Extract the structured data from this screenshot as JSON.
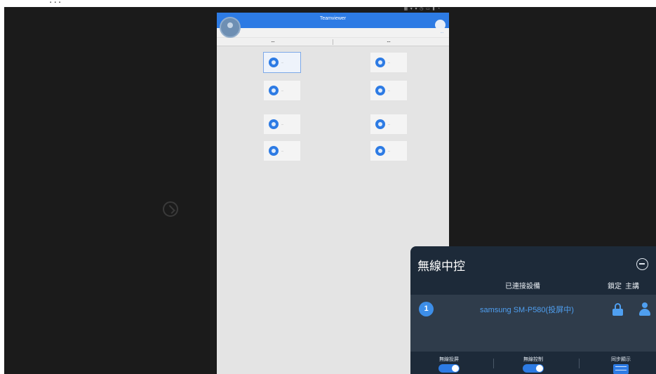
{
  "page": {
    "caption": "...",
    "status_bar_text": "▦ ▾ ▾ ◷ ▭ ▮ ◔"
  },
  "app": {
    "title": "Teamviewer",
    "subtitle": "...",
    "subtitle_link": "...",
    "columns": {
      "left": "...",
      "right": "..."
    },
    "tiles": [
      {
        "label": "...",
        "icon": "circle-app-icon",
        "selected": true
      },
      {
        "label": "...",
        "icon": "circle-app-icon",
        "selected": false
      },
      {
        "label": "...",
        "icon": "circle-app-icon",
        "selected": false
      },
      {
        "label": "...",
        "icon": "circle-app-icon",
        "selected": false
      },
      {
        "label": "...",
        "icon": "circle-app-icon",
        "selected": false
      },
      {
        "label": "...",
        "icon": "circle-app-icon",
        "selected": false
      },
      {
        "label": "...",
        "icon": "circle-app-icon",
        "selected": false
      },
      {
        "label": "...",
        "icon": "circle-app-icon",
        "selected": false
      }
    ]
  },
  "wireless_control": {
    "title": "無線中控",
    "col_devices": "已連接設備",
    "col_lock": "鎖定",
    "col_host": "主講",
    "device": {
      "index": "1",
      "name": "samsung SM-P580(投屏中)"
    },
    "toggles": [
      {
        "label": "無線投屏",
        "on": true
      },
      {
        "label": "無線控制",
        "on": true
      },
      {
        "label": "同步顯示",
        "on": true
      }
    ],
    "accent_color": "#2d7be4"
  }
}
